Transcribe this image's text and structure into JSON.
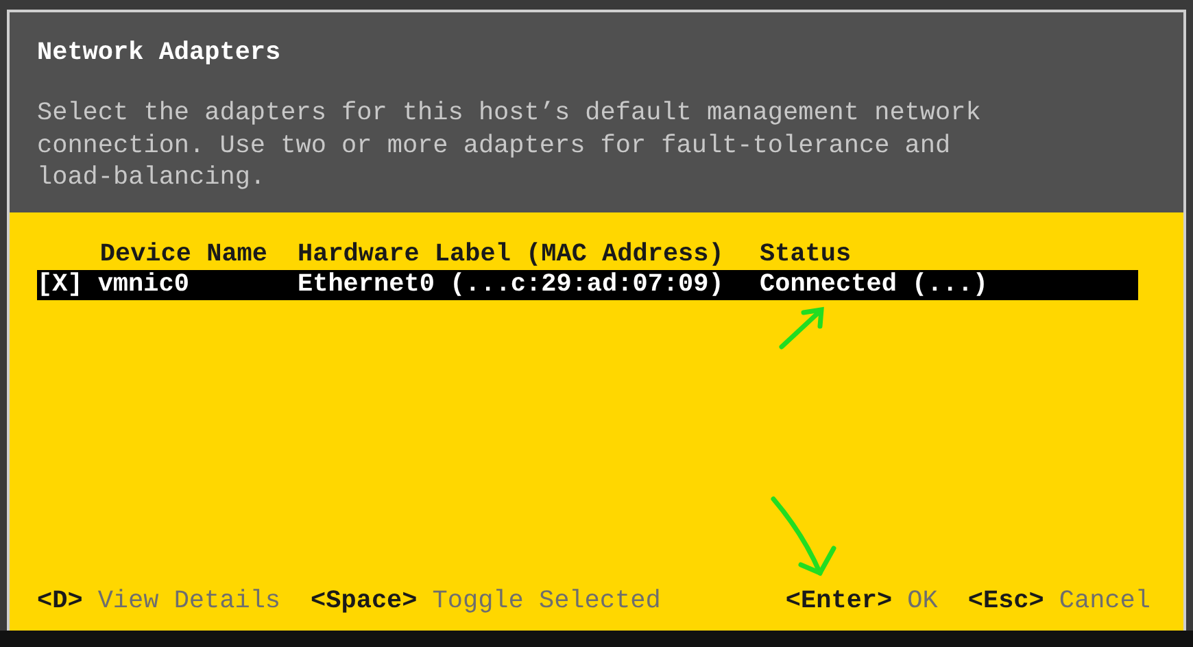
{
  "title": "Network Adapters",
  "description": "Select the adapters for this host’s default management network connection. Use two or more adapters for fault-tolerance and load-balancing.",
  "table": {
    "columns": [
      "Device Name",
      "Hardware Label (MAC Address)",
      "Status"
    ],
    "rows": [
      {
        "checkbox": "[X]",
        "device_name": "vmnic0",
        "hardware_label": "Ethernet0 (...c:29:ad:07:09)",
        "status": "Connected (...)",
        "selected": true
      }
    ]
  },
  "footer": {
    "left": [
      {
        "key": "<D>",
        "label": "View Details"
      },
      {
        "key": "<Space>",
        "label": "Toggle Selected"
      }
    ],
    "right": [
      {
        "key": "<Enter>",
        "label": "OK"
      },
      {
        "key": "<Esc>",
        "label": "Cancel"
      }
    ]
  }
}
